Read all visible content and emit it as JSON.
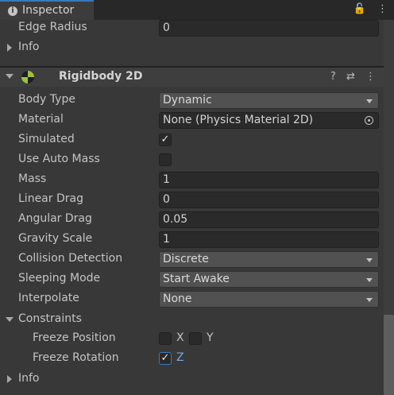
{
  "tab": {
    "title": "Inspector",
    "info_icon": "info-icon"
  },
  "tab_icons": {
    "lock": "🔓",
    "menu": "⋮"
  },
  "pre_rows": [
    {
      "label": "Edge Radius",
      "value": "0"
    },
    {
      "label": "Info"
    }
  ],
  "component": {
    "title": "Rigidbody 2D",
    "help": "?",
    "settings": "⇄",
    "menu": "⋮"
  },
  "fields": {
    "body_type": {
      "label": "Body Type",
      "value": "Dynamic"
    },
    "material": {
      "label": "Material",
      "value": "None (Physics Material 2D)"
    },
    "simulated": {
      "label": "Simulated",
      "checked": true
    },
    "use_auto_mass": {
      "label": "Use Auto Mass",
      "checked": false
    },
    "mass": {
      "label": "Mass",
      "value": "1"
    },
    "linear_drag": {
      "label": "Linear Drag",
      "value": "0"
    },
    "angular_drag": {
      "label": "Angular Drag",
      "value": "0.05"
    },
    "gravity_scale": {
      "label": "Gravity Scale",
      "value": "1"
    },
    "collision_detection": {
      "label": "Collision Detection",
      "value": "Discrete"
    },
    "sleeping_mode": {
      "label": "Sleeping Mode",
      "value": "Start Awake"
    },
    "interpolate": {
      "label": "Interpolate",
      "value": "None"
    }
  },
  "constraints": {
    "label": "Constraints",
    "freeze_position": {
      "label": "Freeze Position",
      "x": "X",
      "y": "Y",
      "x_checked": false,
      "y_checked": false
    },
    "freeze_rotation": {
      "label": "Freeze Rotation",
      "z": "Z",
      "z_checked": true
    }
  },
  "info": {
    "label": "Info"
  },
  "check_mark": "✓"
}
